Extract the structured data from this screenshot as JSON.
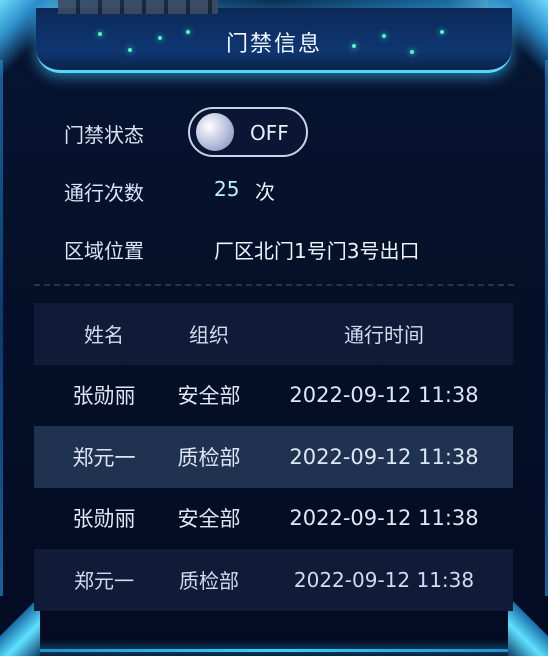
{
  "header": {
    "title": "门禁信息"
  },
  "info": {
    "status_label": "门禁状态",
    "status_value": "OFF",
    "count_label": "通行次数",
    "count_value": "25",
    "count_unit": "次",
    "area_label": "区域位置",
    "area_value": "厂区北门1号门3号出口"
  },
  "table": {
    "columns": [
      "姓名",
      "组织",
      "通行时间"
    ],
    "rows": [
      {
        "name": "张勋丽",
        "org": "安全部",
        "time": "2022-09-12 11:38"
      },
      {
        "name": "郑元一",
        "org": "质检部",
        "time": "2022-09-12 11:38"
      },
      {
        "name": "张勋丽",
        "org": "安全部",
        "time": "2022-09-12 11:38"
      },
      {
        "name": "郑元一",
        "org": "质检部",
        "time": "2022-09-12 11:38"
      }
    ]
  },
  "colors": {
    "accent": "#56d7ff",
    "glow_dot": "#4ff6c9",
    "row_alt": "#1f3350",
    "header_row": "#111a37"
  }
}
